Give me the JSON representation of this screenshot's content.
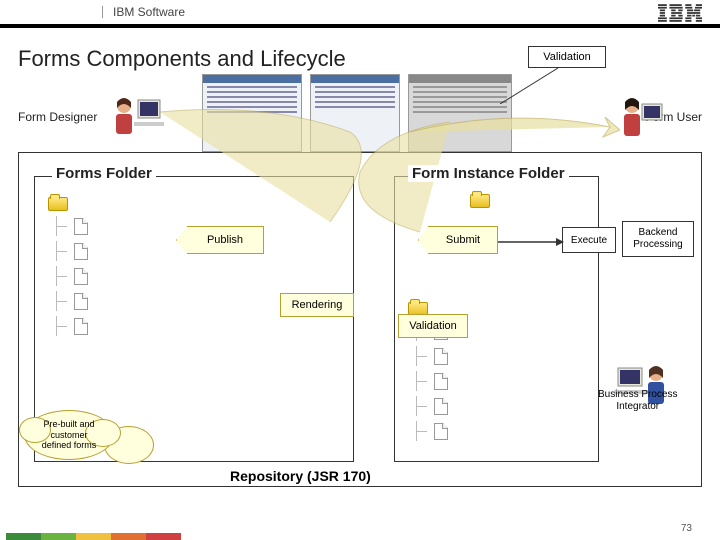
{
  "header": {
    "software": "IBM Software",
    "logo": "IBM"
  },
  "title": "Forms Components and Lifecycle",
  "roles": {
    "designer": "Form Designer",
    "user": "Form User",
    "bpi": "Business Process\nIntegrator"
  },
  "boxes": {
    "validation_top": "Validation",
    "forms_folder": "Forms Folder",
    "instance_folder": "Form Instance Folder",
    "publish": "Publish",
    "submit": "Submit",
    "rendering": "Rendering",
    "validation_mid": "Validation",
    "execute": "Execute",
    "backend": "Backend\nProcessing",
    "prebuilt": "Pre-built and\ncustomer\ndefined forms",
    "repository": "Repository (JSR 170)"
  },
  "page_number": "73"
}
